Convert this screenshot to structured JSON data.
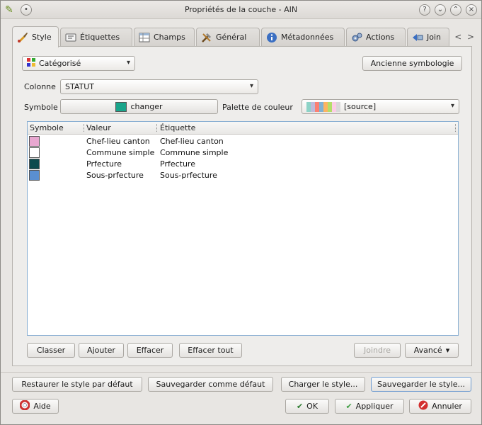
{
  "window": {
    "title": "Propriétés de la couche - AIN"
  },
  "tabs": [
    {
      "label": "Style",
      "icon": "brush-icon"
    },
    {
      "label": "Étiquettes",
      "icon": "label-icon"
    },
    {
      "label": "Champs",
      "icon": "table-icon"
    },
    {
      "label": "Général",
      "icon": "tools-icon"
    },
    {
      "label": "Métadonnées",
      "icon": "info-icon"
    },
    {
      "label": "Actions",
      "icon": "gears-icon"
    },
    {
      "label": "Join",
      "icon": "join-icon"
    }
  ],
  "style": {
    "renderer": "Catégorisé",
    "old_symbology_button": "Ancienne symbologie",
    "column_label": "Colonne",
    "column_value": "STATUT",
    "symbol_label": "Symbole",
    "symbol_button": "changer",
    "symbol_color": "#1aa58b",
    "palette_label": "Palette de couleur",
    "palette_value": "[source]",
    "palette_colors": [
      "#8dd3c7",
      "#bebada",
      "#fb8072",
      "#80b1d3",
      "#fdb462",
      "#b3de69",
      "#fccde5",
      "#d9d9d9"
    ]
  },
  "table": {
    "headers": [
      "Symbole",
      "Valeur",
      "Étiquette"
    ],
    "rows": [
      {
        "color": "#e8a7d0",
        "value": "Chef-lieu canton",
        "label": "Chef-lieu canton"
      },
      {
        "color": "#ffffff",
        "value": "Commune simple",
        "label": "Commune simple"
      },
      {
        "color": "#0b4a4e",
        "value": "Prfecture",
        "label": "Prfecture"
      },
      {
        "color": "#5a8fd1",
        "value": "Sous-prfecture",
        "label": "Sous-prfecture"
      }
    ]
  },
  "table_buttons": {
    "classify": "Classer",
    "add": "Ajouter",
    "delete": "Effacer",
    "delete_all": "Effacer tout",
    "join": "Joindre",
    "advanced": "Avancé"
  },
  "style_buttons": {
    "restore_default": "Restaurer le style par défaut",
    "save_default": "Sauvegarder comme défaut",
    "load_style": "Charger le style...",
    "save_style": "Sauvegarder le style..."
  },
  "dialog_buttons": {
    "help": "Aide",
    "ok": "OK",
    "apply": "Appliquer",
    "cancel": "Annuler"
  }
}
